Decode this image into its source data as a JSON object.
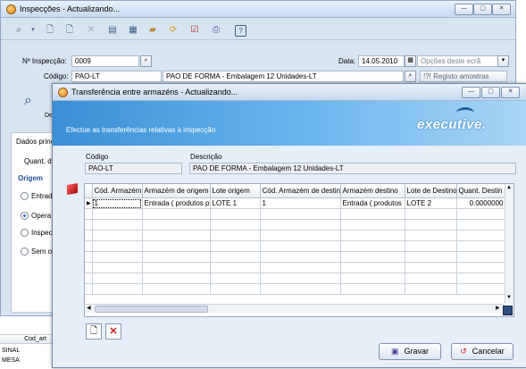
{
  "main_window": {
    "title": "Inspecções - Actualizando...",
    "toolbar_icons": [
      "search-icon",
      "dropdown-icon",
      "new-doc-icon",
      "copy-doc-icon",
      "delete-icon",
      "list-icon",
      "grid-icon",
      "folder-icon",
      "refresh-icon",
      "checklist-icon",
      "print-icon",
      "help-icon"
    ],
    "inspecao_label": "Nº Inspecção:",
    "inspecao_value": "0009",
    "data_label": "Data:",
    "data_value": "14.05.2010",
    "codigo_label": "Código:",
    "codigo_value": "PAO-LT",
    "codigo_desc": "PAO DE FORMA - Embalagem 12 Unidades-LT",
    "opcoes_placeholder": "Opções deste ecrã",
    "registo_label": "!?! Registo amostras",
    "side_label": "De",
    "dados_label": "Dados princ",
    "quant_label": "Quant. d",
    "origem_label": "Origem",
    "radios": [
      {
        "label": "Entrad",
        "checked": false
      },
      {
        "label": "Opera",
        "checked": true
      },
      {
        "label": "Inspec",
        "checked": false
      },
      {
        "label": "Sem o",
        "checked": false
      }
    ]
  },
  "background_list": {
    "header": "Cod_art",
    "rows": [
      "SINAL",
      "MESA"
    ]
  },
  "dialog": {
    "title": "Transferência entre armazéns - Actualizando...",
    "banner_text": "Efectue as transferências relativas à inspecção",
    "brand": "executive.",
    "codigo_label": "Código",
    "codigo_value": "PAO-LT",
    "descricao_label": "Descrição",
    "descricao_value": "PAO DE FORMA - Embalagem 12 Unidades-LT",
    "columns": [
      "Cód. Armazém",
      "Armazém de origem",
      "Lote origem",
      "Cód. Armazém de destino",
      "Armazém destino",
      "Lote de Destino",
      "Quant. Destin"
    ],
    "rows": [
      [
        "1",
        "Entrada ( produtos p",
        "LOTE 1",
        "1",
        "Entrada ( produtos",
        "LOTE 2",
        "0.0000000"
      ]
    ],
    "gravar_label": "Gravar",
    "cancelar_label": "Cancelar"
  }
}
